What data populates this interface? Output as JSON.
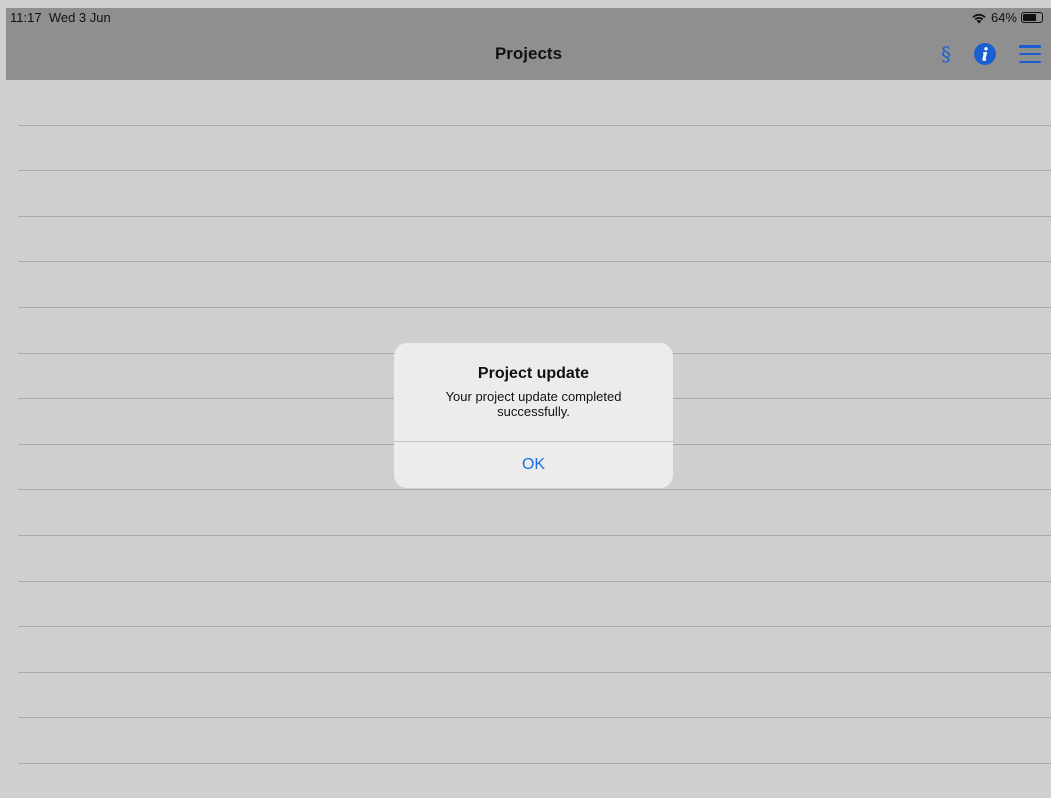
{
  "status_bar": {
    "time": "11:17",
    "date": "Wed 3 Jun",
    "battery_percent": "64%",
    "battery_level": 0.64
  },
  "nav_bar": {
    "title": "Projects",
    "section_icon_glyph": "§",
    "icons": [
      "section-icon",
      "info-icon",
      "menu-icon"
    ],
    "accent_color": "#1a5fd1"
  },
  "list": {
    "row_count": 15
  },
  "alert": {
    "title": "Project update",
    "message": "Your project update completed successfully.",
    "ok_label": "OK",
    "button_color": "#1a6fe0"
  }
}
